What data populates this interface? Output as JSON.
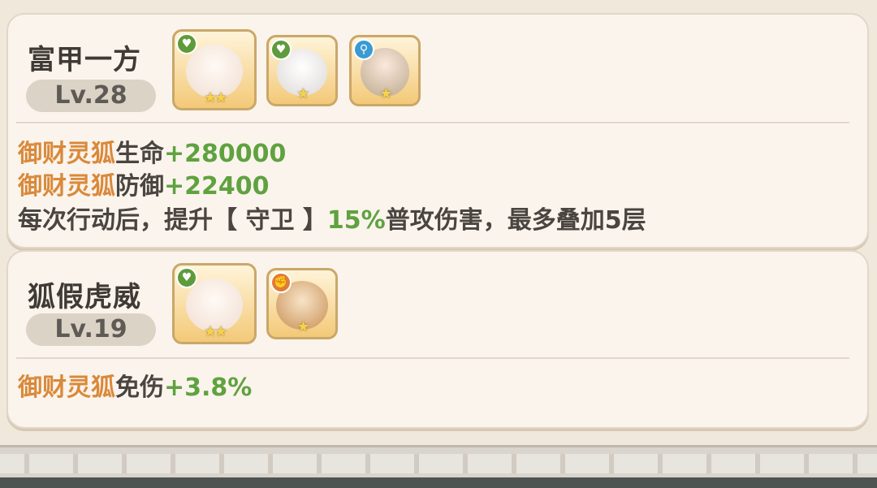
{
  "sets": [
    {
      "title": "富甲一方",
      "level": "Lv.28",
      "portraits": [
        {
          "name": "fox-spirit",
          "badge_icon": "heart-icon",
          "badge_color": "#5e9b3b",
          "stars": "★★"
        },
        {
          "name": "sheep-girl",
          "badge_icon": "heart-icon",
          "badge_color": "#5e9b3b",
          "stars": "★"
        },
        {
          "name": "white-hair-boy",
          "badge_icon": "key-icon",
          "badge_color": "#3a9bd1",
          "stars": "★"
        }
      ],
      "effects": [
        {
          "prefix": "御财灵狐",
          "label": "生命",
          "value": "+280000"
        },
        {
          "prefix": "御财灵狐",
          "label": "防御",
          "value": "+22400"
        }
      ],
      "extra": {
        "text_a": "每次行动后，提升【 守卫 】",
        "value": "15%",
        "text_b": "普攻伤害，最多叠加5层"
      }
    },
    {
      "title": "狐假虎威",
      "level": "Lv.19",
      "portraits": [
        {
          "name": "fox-spirit",
          "badge_icon": "heart-icon",
          "badge_color": "#5e9b3b",
          "stars": "★★"
        },
        {
          "name": "lion-warrior",
          "badge_icon": "fist-icon",
          "badge_color": "#e07b37",
          "stars": "★"
        }
      ],
      "effects": [
        {
          "prefix": "御财灵狐",
          "label": "免伤",
          "value": "+3.8%"
        }
      ]
    }
  ],
  "colors": {
    "accent_orange": "#d9893b",
    "accent_green": "#5fa240",
    "text_dark": "#4a4540"
  }
}
